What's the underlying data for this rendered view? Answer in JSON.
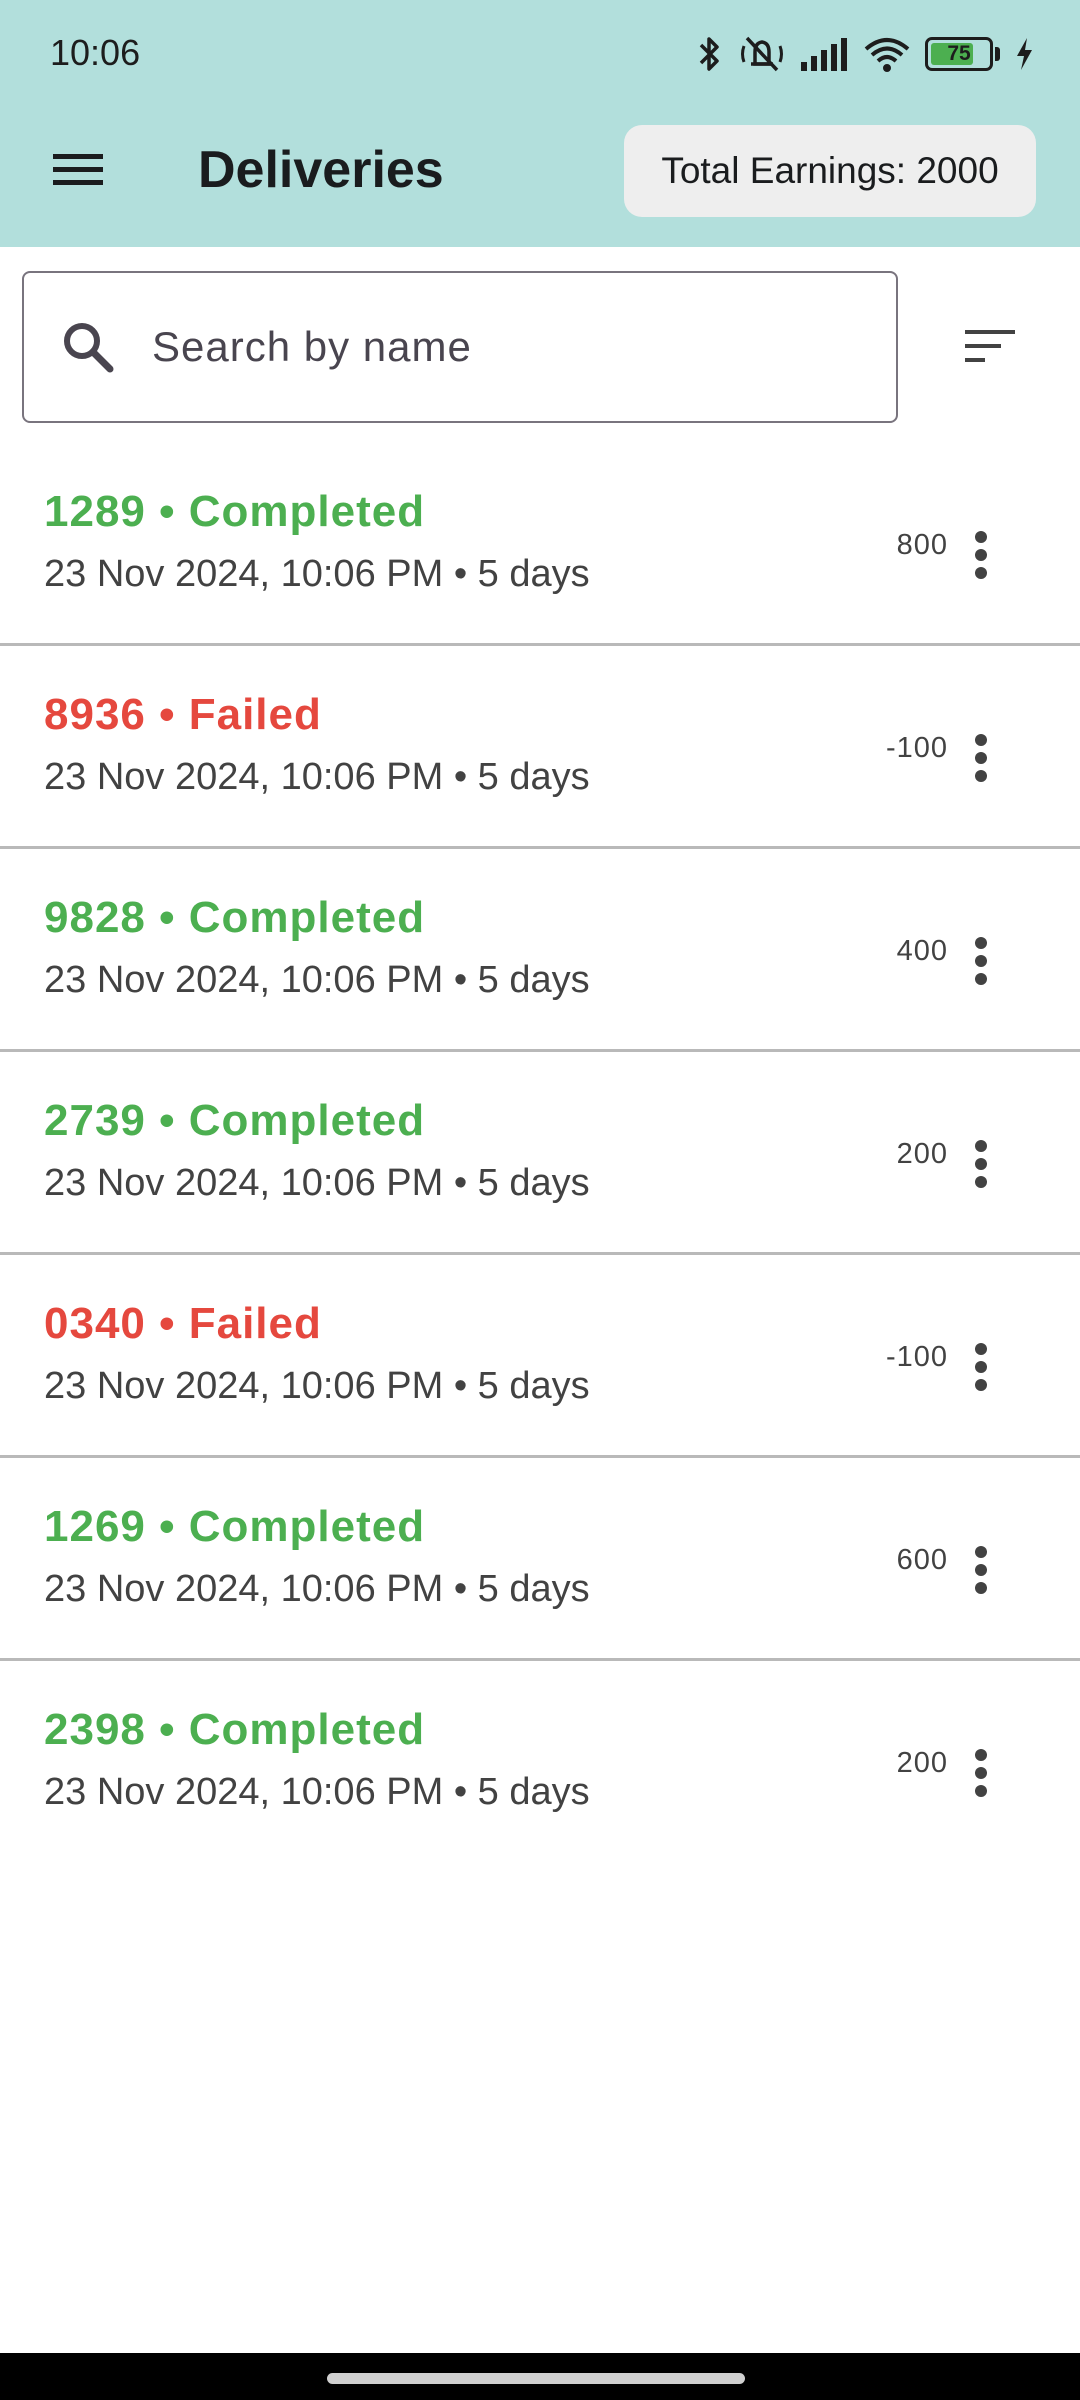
{
  "status_bar": {
    "time": "10:06",
    "battery_level": "75",
    "battery_fraction": 0.75,
    "icons": [
      "bluetooth-icon",
      "vibrate-off-icon",
      "signal-icon",
      "wifi-icon",
      "battery-icon",
      "charging-icon"
    ]
  },
  "header": {
    "title": "Deliveries",
    "total_earnings": "Total Earnings: 2000",
    "menu_icon": "menu-icon"
  },
  "search": {
    "placeholder": "Search by name",
    "value": "",
    "sort_icon": "sort-icon"
  },
  "colors": {
    "app_bar": "#b2dfdc",
    "completed": "#4caf50",
    "failed": "#e5483e"
  },
  "deliveries": [
    {
      "title": "1289 • Completed",
      "status": "completed",
      "subtitle": "23 Nov 2024, 10:06 PM • 5 days",
      "amount": "800"
    },
    {
      "title": "8936 • Failed",
      "status": "failed",
      "subtitle": "23 Nov 2024, 10:06 PM • 5 days",
      "amount": "-100"
    },
    {
      "title": "9828 • Completed",
      "status": "completed",
      "subtitle": "23 Nov 2024, 10:06 PM • 5 days",
      "amount": "400"
    },
    {
      "title": "2739 • Completed",
      "status": "completed",
      "subtitle": "23 Nov 2024, 10:06 PM • 5 days",
      "amount": "200"
    },
    {
      "title": "0340 • Failed",
      "status": "failed",
      "subtitle": "23 Nov 2024, 10:06 PM • 5 days",
      "amount": "-100"
    },
    {
      "title": "1269 • Completed",
      "status": "completed",
      "subtitle": "23 Nov 2024, 10:06 PM • 5 days",
      "amount": "600"
    },
    {
      "title": "2398 • Completed",
      "status": "completed",
      "subtitle": "23 Nov 2024, 10:06 PM • 5 days",
      "amount": "200"
    }
  ]
}
